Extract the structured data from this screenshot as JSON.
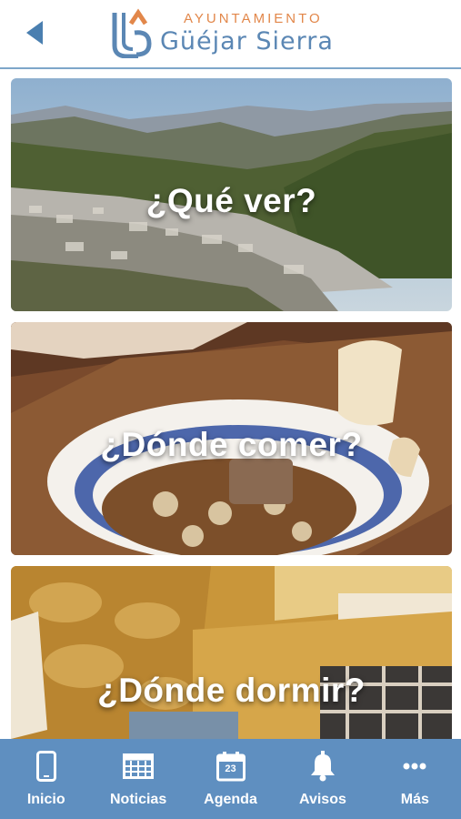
{
  "header": {
    "back_icon": "back-arrow-icon",
    "logo": {
      "top_text": "AYUNTAMIENTO",
      "main_text": "Güéjar Sierra",
      "colors": {
        "orange": "#e2874a",
        "blue": "#5b87b4"
      }
    }
  },
  "cards": [
    {
      "title": "¿Qué ver?",
      "image": "mountain-village-landscape"
    },
    {
      "title": "¿Dónde comer?",
      "image": "stew-bowl-with-bread"
    },
    {
      "title": "¿Dónde dormir?",
      "image": "stone-wall-bedroom"
    }
  ],
  "tabbar": {
    "background": "#5f8fc0",
    "tabs": [
      {
        "label": "Inicio",
        "icon": "phone-icon"
      },
      {
        "label": "Noticias",
        "icon": "newspaper-icon"
      },
      {
        "label": "Agenda",
        "icon": "calendar-icon",
        "icon_text": "23"
      },
      {
        "label": "Avisos",
        "icon": "bell-icon"
      },
      {
        "label": "Más",
        "icon": "more-dots-icon"
      }
    ]
  }
}
